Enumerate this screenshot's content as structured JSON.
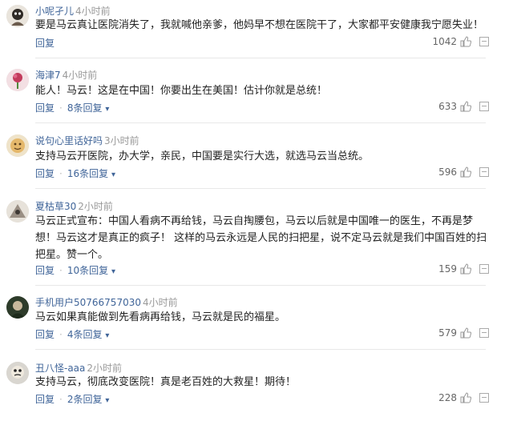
{
  "comments": [
    {
      "user": "小呢孑儿",
      "time": "4小时前",
      "text": "要是马云真让医院消失了，我就喊他亲爹，他妈早不想在医院干了，大家都平安健康我宁愿失业！",
      "reply": "回复",
      "replies": "",
      "likes": "1042"
    },
    {
      "user": "海津7",
      "time": "4小时前",
      "text": "能人！马云！这是在中国！你要出生在美国！估计你就是总统！",
      "reply": "回复",
      "replies": "8条回复",
      "likes": "633"
    },
    {
      "user": "说句心里话好吗",
      "time": "3小时前",
      "text": "支持马云开医院，办大学，亲民，中国要是实行大选，就选马云当总统。",
      "reply": "回复",
      "replies": "16条回复",
      "likes": "596"
    },
    {
      "user": "夏枯草30",
      "time": "2小时前",
      "text": "马云正式宣布：中国人看病不再给钱，马云自掏腰包，马云以后就是中国唯一的医生，不再是梦想！马云这才是真正的疯子！ 这样的马云永远是人民的扫把星，说不定马云就是我们中国百姓的扫把星。赞一个。",
      "reply": "回复",
      "replies": "10条回复",
      "likes": "159"
    },
    {
      "user": "手机用户50766757030",
      "time": "4小时前",
      "text": "马云如果真能做到先看病再给钱，马云就是民的福星。",
      "reply": "回复",
      "replies": "4条回复",
      "likes": "579"
    },
    {
      "user": "丑八怪-aaa",
      "time": "2小时前",
      "text": "支持马云，彻底改变医院！真是老百姓的大救星！期待！",
      "reply": "回复",
      "replies": "2条回复",
      "likes": "228"
    }
  ],
  "icons": {
    "like": "thumbs-up-icon",
    "report": "report-icon",
    "expand": "chevron-down-icon"
  },
  "colors": {
    "username": "#406599",
    "timestamp": "#999999",
    "text": "#222222"
  }
}
